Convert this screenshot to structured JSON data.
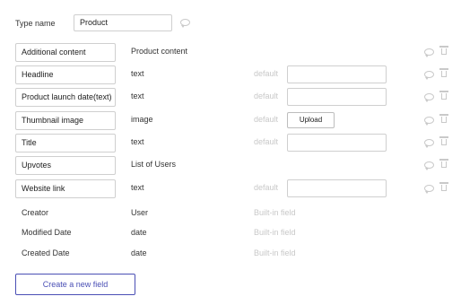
{
  "type_name": {
    "label": "Type name",
    "value": "Product"
  },
  "fields": [
    {
      "name": "Additional content",
      "type": "Product content",
      "has_default": false
    },
    {
      "name": "Headline",
      "type": "text",
      "has_default": true,
      "default_kind": "input"
    },
    {
      "name": "Product launch date(text)",
      "type": "text",
      "has_default": true,
      "default_kind": "input"
    },
    {
      "name": "Thumbnail image",
      "type": "image",
      "has_default": true,
      "default_kind": "upload"
    },
    {
      "name": "Title",
      "type": "text",
      "has_default": true,
      "default_kind": "input"
    },
    {
      "name": "Upvotes",
      "type": "List of Users",
      "has_default": false
    },
    {
      "name": "Website link",
      "type": "text",
      "has_default": true,
      "default_kind": "input"
    }
  ],
  "default_label": "default",
  "upload_label": "Upload",
  "builtin_fields": [
    {
      "name": "Creator",
      "type": "User"
    },
    {
      "name": "Modified Date",
      "type": "date"
    },
    {
      "name": "Created Date",
      "type": "date"
    }
  ],
  "builtin_label": "Built-in field",
  "create_button_label": "Create a new field",
  "icons": {
    "comment": "speech-bubble-icon",
    "delete": "trash-icon"
  },
  "colors": {
    "accent": "#4a4fb5",
    "muted": "#c8c8c8"
  }
}
